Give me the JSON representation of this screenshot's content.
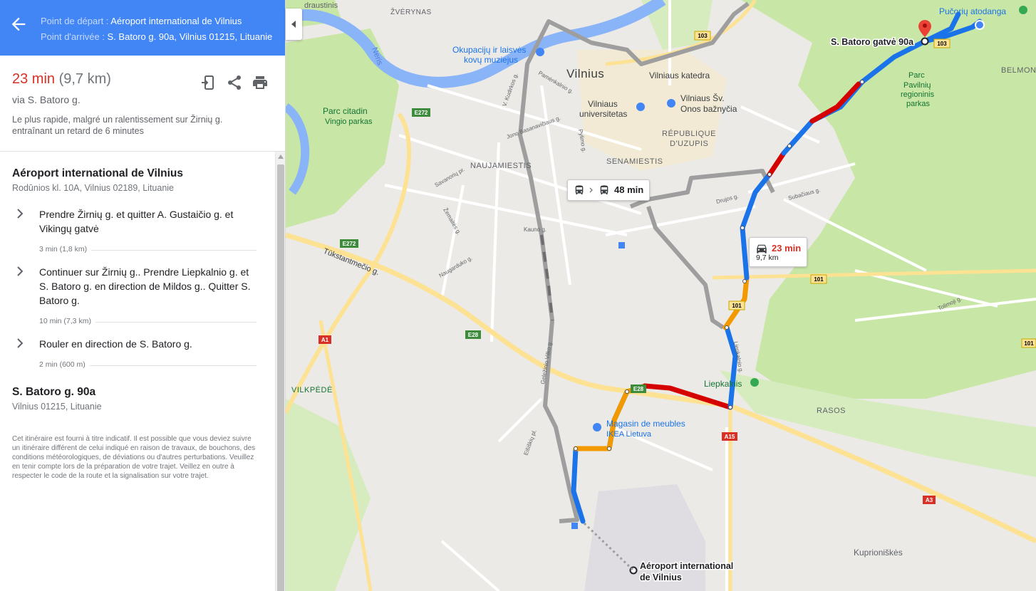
{
  "header": {
    "from_label": "Point de départ : ",
    "from_value": "Aéroport international de Vilnius",
    "to_label": "Point d'arrivée : ",
    "to_value": "S. Batoro g. 90a, Vilnius 01215, Lituanie"
  },
  "summary": {
    "time": "23 min",
    "distance": "(9,7 km)",
    "via": "via S. Batoro g.",
    "description": "Le plus rapide, malgré un ralentissement sur Žirnių g. entraînant un retard de 6 minutes"
  },
  "origin": {
    "title": "Aéroport international de Vilnius",
    "address": "Rodūnios kl. 10A, Vilnius 02189, Lituanie"
  },
  "steps": [
    {
      "text": "Prendre Žirnių g. et quitter A. Gustaičio g. et Vikingų gatvė",
      "meta": "3 min (1,8 km)"
    },
    {
      "text": "Continuer sur Žirnių g.. Prendre Liepkalnio g. et S. Batoro g. en direction de Mildos g.. Quitter S. Batoro g.",
      "meta": "10 min (7,3 km)"
    },
    {
      "text": "Rouler en direction de S. Batoro g.",
      "meta": "2 min (600 m)"
    }
  ],
  "destination": {
    "title": "S. Batoro g. 90a",
    "address": "Vilnius 01215, Lituanie"
  },
  "disclaimer": "Cet itinéraire est fourni à titre indicatif. Il est possible que vous deviez suivre un itinéraire différent de celui indiqué en raison de travaux, de bouchons, des conditions météorologiques, de déviations ou d'autres perturbations. Veuillez en tenir compte lors de la préparation de votre trajet. Veillez en outre à respecter le code de la route et la signalisation sur votre trajet.",
  "map": {
    "transit_time": "48 min",
    "drive_time": "23 min",
    "drive_distance": "9,7 km",
    "dest_marker_label": "S. Batoro gatvė 90a",
    "origin_marker_label_1": "Aéroport international",
    "origin_marker_label_2": "de Vilnius",
    "places": {
      "draustinis": "draustinis",
      "zverynas": "ŽVĖRYNAS",
      "neris": "Neris",
      "okupaciju_1": "Okupacijų ir laisvės",
      "okupaciju_2": "kovų muziejus",
      "vilnius": "Vilnius",
      "katedra": "Vilniaus katedra",
      "universitetas_1": "Vilniaus",
      "universitetas_2": "universitetas",
      "onos_1": "Vilniaus Šv.",
      "onos_2": "Onos bažnyčia",
      "parc_citadin_1": "Parc citadin",
      "parc_citadin_2": "Vingio parkas",
      "republique_1": "RÉPUBLIQUE",
      "republique_2": "D'UZUPIS",
      "naujamiestis": "NAUJAMIESTIS",
      "senamiestis": "SENAMIESTIS",
      "pucoriu": "Pučorių atodanga",
      "parc_pavilniu_1": "Parc",
      "parc_pavilniu_2": "Pavilnių",
      "parc_pavilniu_3": "regioninis",
      "parc_pavilniu_4": "parkas",
      "belmont": "BELMON",
      "tukstantmecio": "Tūkstantmečio g.",
      "vilkpede": "VILKPĖDĖ",
      "liepkalnis": "Liepkalnis",
      "rasos": "RASOS",
      "ikea_1": "Magasin de meubles",
      "ikea_2": "IKEA Lietuva",
      "kuprioniskes": "Kuprioniškės",
      "pamenkalnio": "Pamėnkalnio g.",
      "jono_basanaviciaus": "Jono Basanavičiaus g.",
      "savanoriu": "Savanorių pr.",
      "zemaites": "Žemaitės g.",
      "kauno": "Kauno g.",
      "naugarduko": "Naugarduko g.",
      "drujos": "Drujos g.",
      "subaciaus": "Subačiaus g.",
      "tolimoji": "Tolimoji g.",
      "pylimo": "Pylimo g.",
      "liepkalnio": "Liepkalnio g.",
      "ciurlionio": "V. Kudirkos g.",
      "geleziniu": "Geležinio Vilko g.",
      "eisiskiu": "Eišiškių pl."
    },
    "road_shields": {
      "r103a": "103",
      "r103b": "103",
      "e272a": "E272",
      "e272b": "E272",
      "e28a": "E28",
      "e28b": "E28",
      "a1": "A1",
      "a15": "A15",
      "a3": "A3",
      "r101a": "101",
      "r101b": "101",
      "r101c": "101"
    }
  },
  "colors": {
    "header_bg": "#4285f4",
    "route_blue": "#1a73e8",
    "traffic_red": "#d50000",
    "traffic_orange": "#f29900",
    "park_green": "#c8e6a5",
    "water": "#8ab4f8"
  },
  "icons": [
    "arrow-back-icon",
    "send-to-phone-icon",
    "share-icon",
    "print-icon",
    "chevron-right-icon",
    "bus-icon",
    "car-icon",
    "pin-icon"
  ]
}
